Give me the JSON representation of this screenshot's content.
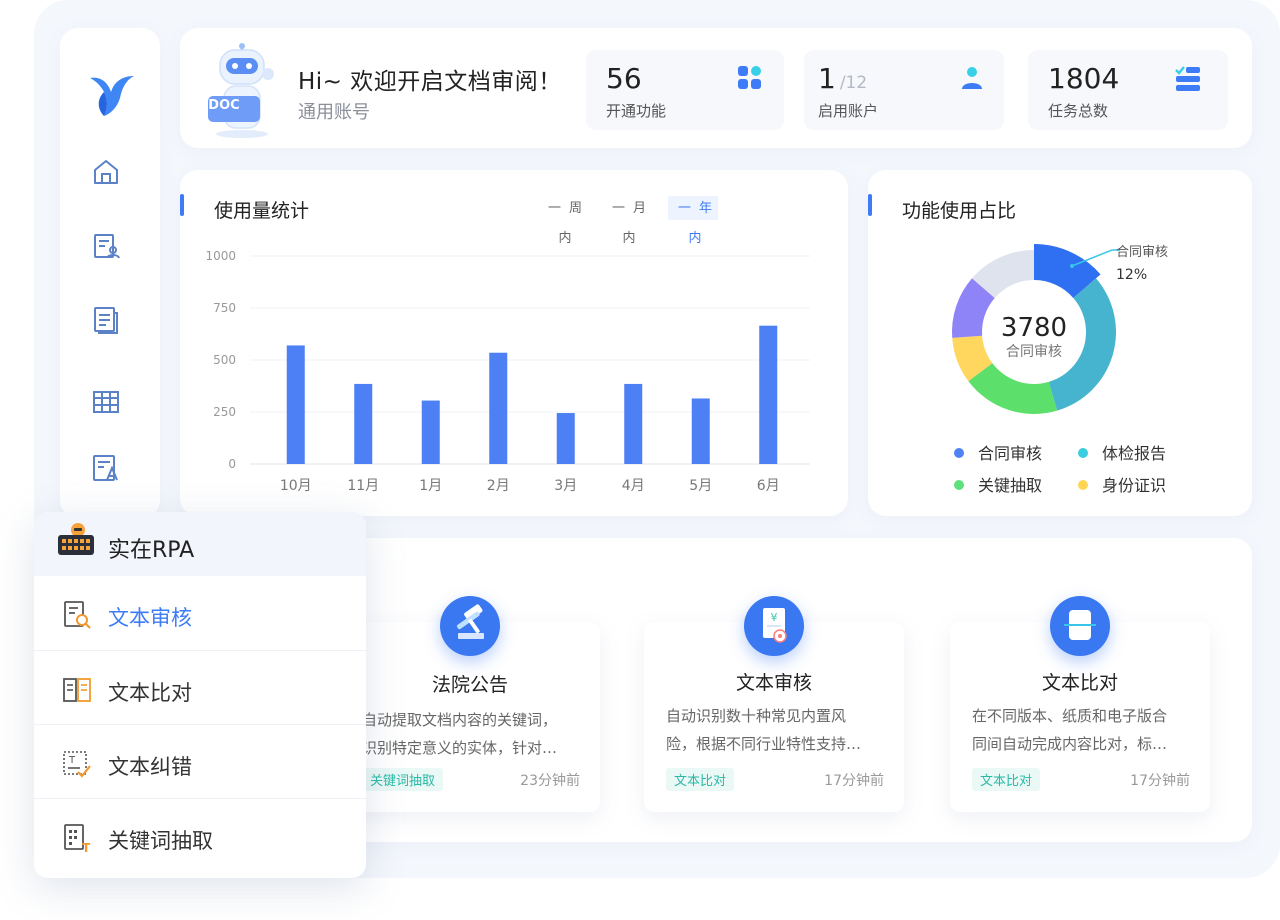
{
  "header": {
    "greeting": "Hi~ 欢迎开启文档审阅！",
    "account": "通用账号",
    "robot_badge": "DOC",
    "stats": [
      {
        "value": "56",
        "label": "开通功能",
        "total": ""
      },
      {
        "value": "1",
        "label": "启用账户",
        "total": "/12"
      },
      {
        "value": "1804",
        "label": "任务总数",
        "total": ""
      }
    ]
  },
  "usage": {
    "title": "使用量统计",
    "tabs": [
      {
        "label": "一周内",
        "active": false
      },
      {
        "label": "一月内",
        "active": false
      },
      {
        "label": "一年内",
        "active": true
      }
    ]
  },
  "pie": {
    "title": "功能使用占比",
    "center_value": "3780",
    "center_label": "合同审核",
    "callout_label": "合同审核",
    "callout_value": "12%",
    "legend": [
      {
        "label": "合同审核",
        "color": "#4f83f3"
      },
      {
        "label": "体检报告",
        "color": "#3ccde0"
      },
      {
        "label": "关键抽取",
        "color": "#5ee07a"
      },
      {
        "label": "身份证识",
        "color": "#ffd556"
      }
    ]
  },
  "chart_data": [
    {
      "type": "bar",
      "categories": [
        "10月",
        "11月",
        "1月",
        "2月",
        "3月",
        "4月",
        "5月",
        "6月"
      ],
      "values": [
        570,
        385,
        305,
        535,
        245,
        385,
        315,
        665
      ],
      "yticks": [
        "0",
        "250",
        "500",
        "750",
        "1000"
      ],
      "ylim": [
        0,
        1000
      ],
      "color": "#4d7ff5",
      "grid": true
    },
    {
      "type": "pie",
      "labels": [],
      "values": [
        12,
        28,
        17,
        8,
        11,
        12
      ],
      "colors": [
        "#2f6ff2",
        "#47b4cf",
        "#5ddf6b",
        "#ffd75e",
        "#8f84f7",
        "#dfe3ee"
      ],
      "donut": true
    }
  ],
  "features": [
    {
      "title": "法院公告",
      "desc1": "自动提取文档内容的关键词，",
      "desc2": "识别特定意义的实体，针对…",
      "tag": "关键词抽取",
      "time": "23分钟前"
    },
    {
      "title": "文本审核",
      "desc1": "自动识别数十种常见内置风",
      "desc2": "险，根据不同行业特性支持…",
      "tag": "文本比对",
      "time": "17分钟前"
    },
    {
      "title": "文本比对",
      "desc1": "在不同版本、纸质和电子版合",
      "desc2": "同间自动完成内容比对，标…",
      "tag": "文本比对",
      "time": "17分钟前"
    }
  ],
  "menu": {
    "header": "实在RPA",
    "items": [
      {
        "label": "文本审核",
        "active": true
      },
      {
        "label": "文本比对",
        "active": false
      },
      {
        "label": "文本纠错",
        "active": false
      },
      {
        "label": "关键词抽取",
        "active": false
      }
    ]
  }
}
